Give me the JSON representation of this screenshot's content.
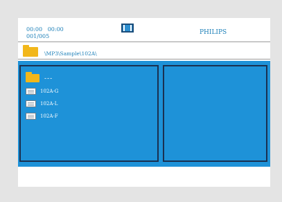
{
  "header": {
    "time_elapsed": "00:00",
    "time_total": "00:00",
    "track_counter": "001/005",
    "brand": "PHILIPS",
    "mode_icon": "display-mode-icon"
  },
  "path": {
    "current_path": "\\MP3\\Sample\\102A\\",
    "icon": "folder-icon"
  },
  "browser": {
    "parent_label": "---",
    "files": [
      {
        "name": "102A-G",
        "icon": "audio-file-icon"
      },
      {
        "name": "102A-L",
        "icon": "audio-file-icon"
      },
      {
        "name": "102A-F",
        "icon": "audio-file-icon"
      }
    ]
  },
  "colors": {
    "panel_bg": "#1e92d8",
    "text_blue": "#1b7fb8",
    "folder": "#f2b71a"
  }
}
